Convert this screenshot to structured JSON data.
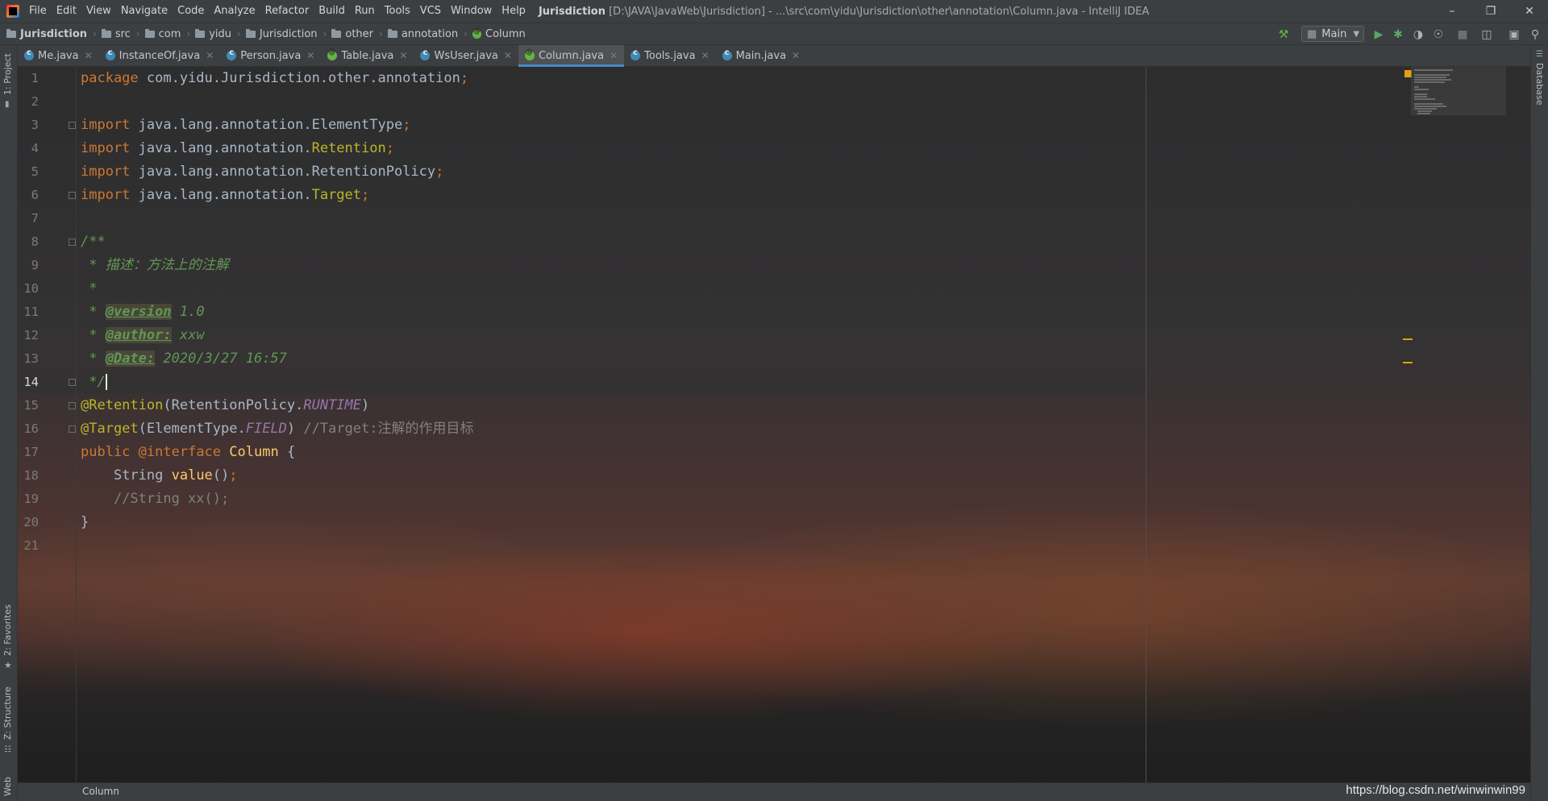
{
  "menu": [
    "File",
    "Edit",
    "View",
    "Navigate",
    "Code",
    "Analyze",
    "Refactor",
    "Build",
    "Run",
    "Tools",
    "VCS",
    "Window",
    "Help"
  ],
  "window_title": {
    "project": "Jurisdiction",
    "rest": "[D:\\JAVA\\JavaWeb\\Jurisdiction] - ...\\src\\com\\yidu\\Jurisdiction\\other\\annotation\\Column.java - IntelliJ IDEA"
  },
  "nav": {
    "crumbs": [
      "Jurisdiction",
      "src",
      "com",
      "yidu",
      "Jurisdiction",
      "other",
      "annotation",
      "Column"
    ],
    "run_config": "Main"
  },
  "tabs": [
    {
      "label": "Me.java",
      "kind": "class"
    },
    {
      "label": "InstanceOf.java",
      "kind": "class"
    },
    {
      "label": "Person.java",
      "kind": "class"
    },
    {
      "label": "Table.java",
      "kind": "annotation"
    },
    {
      "label": "WsUser.java",
      "kind": "class"
    },
    {
      "label": "Column.java",
      "kind": "annotation",
      "active": true
    },
    {
      "label": "Tools.java",
      "kind": "class"
    },
    {
      "label": "Main.java",
      "kind": "class"
    }
  ],
  "side": {
    "project": "1: Project",
    "favorites": "2: Favorites",
    "structure": "Z: Structure",
    "web": "Web",
    "database": "Database"
  },
  "editor": {
    "current_line": 14,
    "line_numbers": [
      "1",
      "2",
      "3",
      "4",
      "5",
      "6",
      "7",
      "8",
      "9",
      "10",
      "11",
      "12",
      "13",
      "14",
      "15",
      "16",
      "17",
      "18",
      "19",
      "20",
      "21"
    ],
    "code": {
      "l1_kw": "package",
      "l1_rest": " com.yidu.Jurisdiction.other.annotation",
      "semi": ";",
      "import_kw": "import",
      "l3_rest": " java.lang.annotation.ElementType",
      "l4_a": " java.lang.annotation.",
      "l4_b": "Retention",
      "l5_rest": " java.lang.annotation.RetentionPolicy",
      "l6_a": " java.lang.annotation.",
      "l6_b": "Target",
      "l8": "/**",
      "l9": " * 描述：方法上的注解",
      "l10": " *",
      "doc_star": " * ",
      "l11_tag": "@version",
      "l11_val": " 1.0",
      "l12_tag": "@author:",
      "l12_val": " xxw",
      "l13_tag": "@Date:",
      "l13_val": " 2020/3/27 16:57",
      "l14": " */",
      "l15_ann": "@Retention",
      "l15_a": "(RetentionPolicy.",
      "l15_field": "RUNTIME",
      "l15_b": ")",
      "l16_ann": "@Target",
      "l16_a": "(ElementType.",
      "l16_field": "FIELD",
      "l16_b": ")",
      "l16_cmt": " //Target:注解的作用目标",
      "l17_kw": "public",
      "l17_kw2": "@interface",
      "l17_name": "Column",
      "l17_brace": " {",
      "l18_indent": "    ",
      "l18_type": "String ",
      "l18_mth": "value",
      "l18_par": "()",
      "l19": "    //String xx();",
      "l20": "}"
    }
  },
  "status": {
    "breadcrumb": "Column",
    "watermark": "https://blog.csdn.net/winwinwin99"
  }
}
